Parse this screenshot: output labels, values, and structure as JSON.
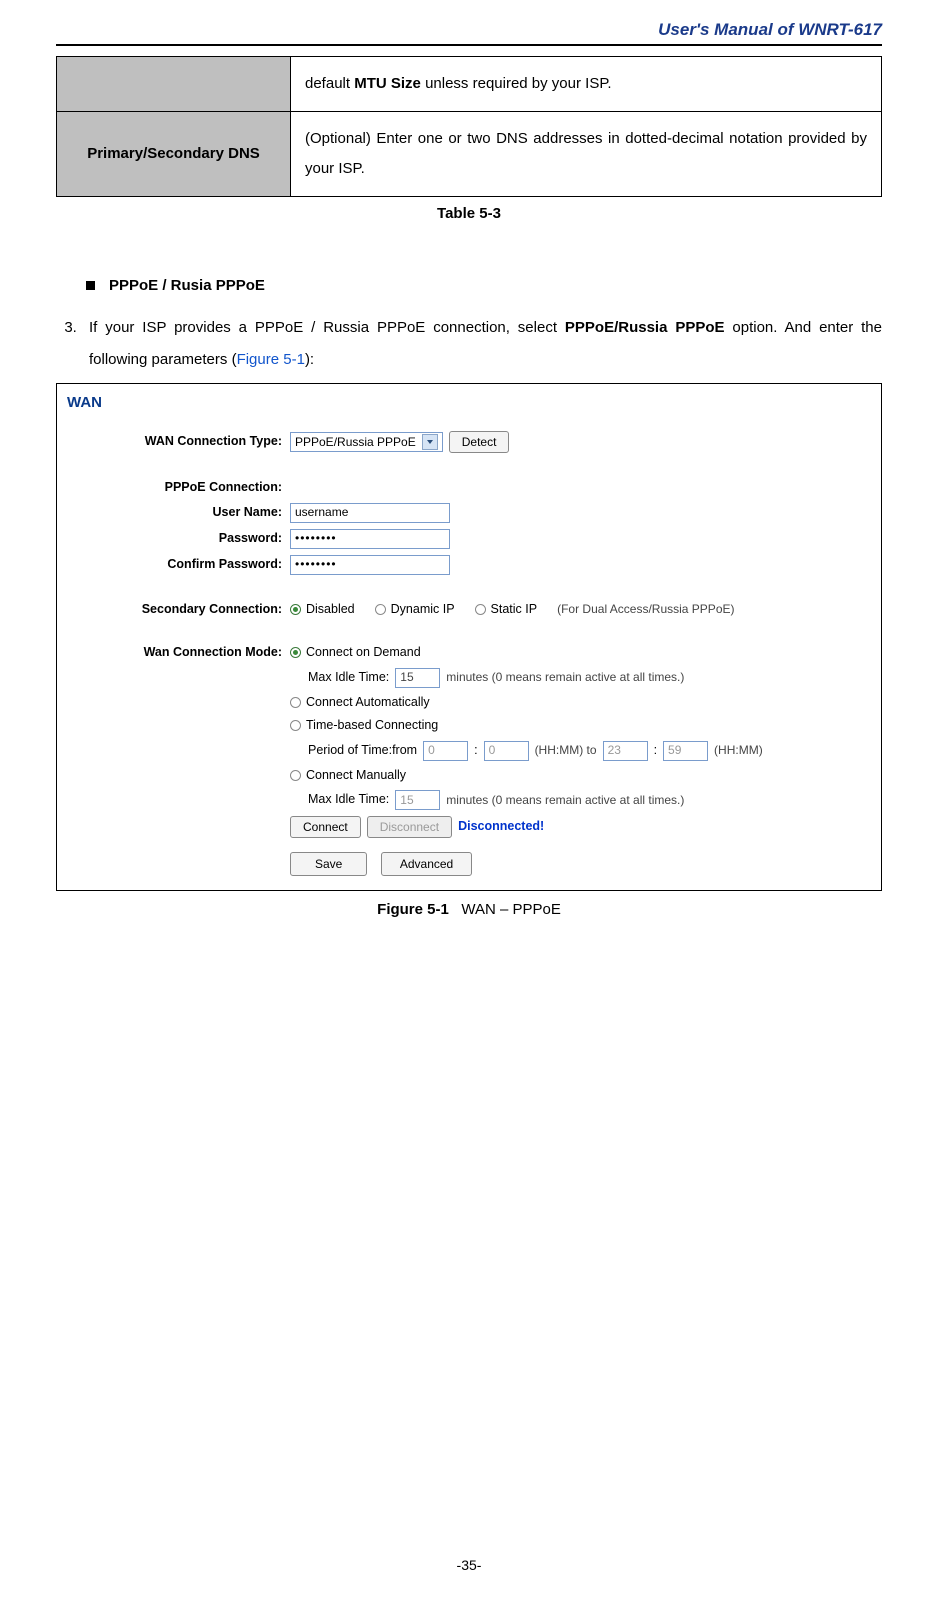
{
  "header": {
    "title": "User's Manual of WNRT-617"
  },
  "table": {
    "rows": [
      {
        "th": "",
        "td_prefix": "default ",
        "td_bold": "MTU Size",
        "td_suffix": " unless required by your ISP."
      },
      {
        "th": "Primary/Secondary DNS",
        "td_prefix": "(Optional) Enter one or two DNS addresses in dotted-decimal notation provided by your ISP.",
        "td_bold": "",
        "td_suffix": ""
      }
    ],
    "caption": "Table    5-3"
  },
  "section": {
    "title": "PPPoE / Rusia PPPoE"
  },
  "step": {
    "num": "3.",
    "text_prefix": "If your ISP provides a PPPoE / Russia PPPoE connection, select ",
    "bold": "PPPoE/Russia PPPoE",
    "text_mid": " option. And enter the following parameters (",
    "figref": "Figure 5-1",
    "text_suffix": "):"
  },
  "wan": {
    "title": "WAN",
    "labels": {
      "conn_type": "WAN Connection Type:",
      "pppoe_conn": "PPPoE Connection:",
      "username": "User Name:",
      "password": "Password:",
      "confirm": "Confirm Password:",
      "secondary": "Secondary Connection:",
      "mode": "Wan Connection Mode:"
    },
    "conn_type_value": "PPPoE/Russia PPPoE",
    "detect": "Detect",
    "username_value": "username",
    "password_value": "••••••••",
    "confirm_value": "••••••••",
    "secondary": {
      "disabled": "Disabled",
      "dynamic": "Dynamic IP",
      "static": "Static IP",
      "note": "(For Dual Access/Russia PPPoE)"
    },
    "mode": {
      "on_demand": "Connect on Demand",
      "idle_label": "Max Idle Time:",
      "idle_val1": "15",
      "idle_suffix": "minutes (0 means remain active at all times.)",
      "auto": "Connect Automatically",
      "time": "Time-based Connecting",
      "period_prefix": "Period of Time:from",
      "h1": "0",
      "m1": "0",
      "to": "(HH:MM) to",
      "h2": "23",
      "m2": "59",
      "hhmm": "(HH:MM)",
      "manual": "Connect Manually",
      "idle_val2": "15"
    },
    "connect": "Connect",
    "disconnect": "Disconnect",
    "status": "Disconnected!",
    "save": "Save",
    "advanced": "Advanced"
  },
  "figure_caption": {
    "bold": "Figure 5-1",
    "text": "WAN – PPPoE"
  },
  "page_num": "-35-"
}
